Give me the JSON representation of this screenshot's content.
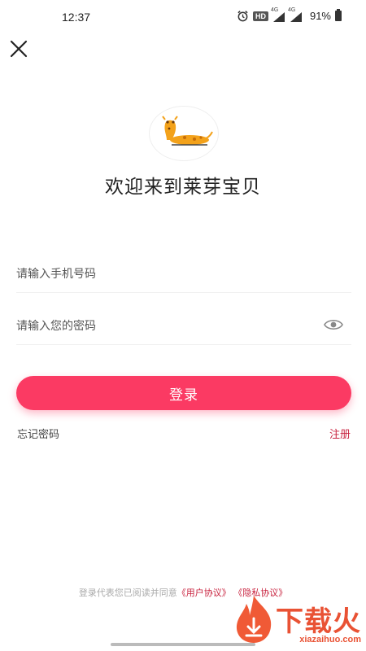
{
  "status_bar": {
    "time": "12:37",
    "hd_label": "HD",
    "network_label": "4G",
    "battery": "91%"
  },
  "icons": {
    "close": "close-icon",
    "logo": "giraffe-logo-icon",
    "eye": "eye-icon",
    "alarm": "alarm-icon"
  },
  "header": {
    "welcome": "欢迎来到莱芽宝贝"
  },
  "form": {
    "phone_placeholder": "请输入手机号码",
    "password_placeholder": "请输入您的密码",
    "login_label": "登录"
  },
  "links": {
    "forgot_password": "忘记密码",
    "register": "注册"
  },
  "agreement": {
    "prefix": "登录代表您已阅读并同意",
    "user_agreement": "《用户协议》",
    "privacy_policy": "《隐私协议》"
  },
  "watermark": {
    "cn": "下载火",
    "en": "xiazaihuo.com"
  },
  "colors": {
    "accent": "#fb3a63",
    "link": "#c8233f"
  }
}
